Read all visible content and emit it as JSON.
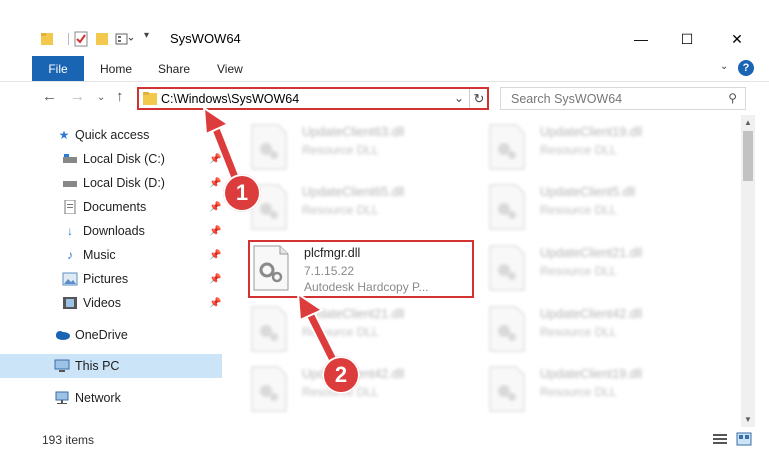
{
  "window": {
    "title": "SysWOW64",
    "minimize": "—",
    "maximize": "☐",
    "close": "✕"
  },
  "ribbon": {
    "file": "File",
    "home": "Home",
    "share": "Share",
    "view": "View",
    "help": "?"
  },
  "nav": {
    "address": "C:\\Windows\\SysWOW64",
    "search_placeholder": "Search SysWOW64"
  },
  "sidebar": {
    "items": [
      {
        "label": "Quick access"
      },
      {
        "label": "Local Disk (C:)"
      },
      {
        "label": "Local Disk (D:)"
      },
      {
        "label": "Documents"
      },
      {
        "label": "Downloads"
      },
      {
        "label": "Music"
      },
      {
        "label": "Pictures"
      },
      {
        "label": "Videos"
      },
      {
        "label": "OneDrive"
      },
      {
        "label": "This PC"
      },
      {
        "label": "Network"
      }
    ]
  },
  "files": [
    {
      "name": "UpdateClient63.dll",
      "type": "Resource DLL"
    },
    {
      "name": "UpdateClient19.dll",
      "type": "Resource DLL"
    },
    {
      "name": "UpdateClient65.dll",
      "type": "Resource DLL"
    },
    {
      "name": "UpdateClient5.dll",
      "type": "Resource DLL"
    },
    {
      "name": "plcfmgr.dll",
      "version": "7.1.15.22",
      "type": "Autodesk Hardcopy P..."
    },
    {
      "name": "UpdateClient21.dll",
      "type": "Resource DLL"
    },
    {
      "name": "UpdateClient21.dll",
      "type": "Resource DLL"
    },
    {
      "name": "UpdateClient42.dll",
      "type": "Resource DLL"
    },
    {
      "name": "UpdateClient42.dll",
      "type": "Resource DLL"
    },
    {
      "name": "UpdateClient19.dll",
      "type": "Resource DLL"
    }
  ],
  "status": {
    "count": "193 items"
  },
  "annotations": {
    "step1": "1",
    "step2": "2"
  },
  "colors": {
    "accent": "#1a64b4",
    "highlight": "#d23232",
    "selected": "#cce4f7"
  }
}
